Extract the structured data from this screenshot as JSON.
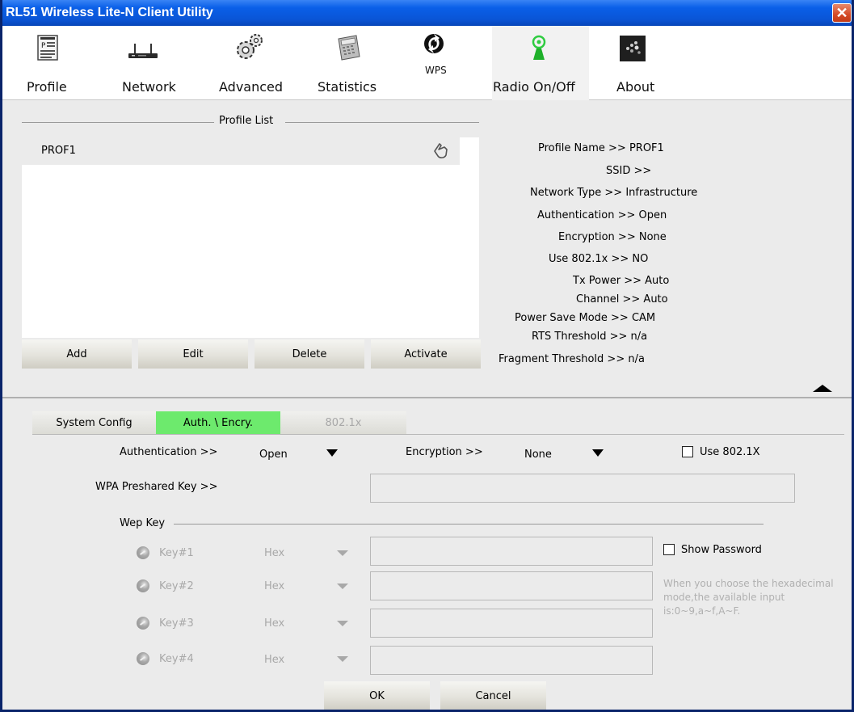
{
  "window": {
    "title": "RL51 Wireless Lite-N Client Utility",
    "close_glyph": "✕"
  },
  "toolbar": {
    "items": [
      {
        "label": "Profile",
        "icon": "profile-icon"
      },
      {
        "label": "Network",
        "icon": "router-icon"
      },
      {
        "label": "Advanced",
        "icon": "gears-icon"
      },
      {
        "label": "Statistics",
        "icon": "calculator-icon"
      },
      {
        "label": "WPS",
        "icon": "wps-icon"
      },
      {
        "label": "Radio On/Off",
        "icon": "radio-antenna-icon"
      },
      {
        "label": "About",
        "icon": "about-icon"
      }
    ]
  },
  "profile_list": {
    "header": "Profile List",
    "rows": [
      {
        "name": "PROF1",
        "icon": "hand-pointer-icon"
      }
    ],
    "buttons": {
      "add": "Add",
      "edit": "Edit",
      "delete": "Delete",
      "activate": "Activate"
    }
  },
  "details": [
    {
      "text": "Profile Name >> PROF1"
    },
    {
      "text": "SSID >>"
    },
    {
      "text": "Network Type >> Infrastructure"
    },
    {
      "text": "Authentication >> Open"
    },
    {
      "text": "Encryption >> None"
    },
    {
      "text": "Use 802.1x >> NO"
    },
    {
      "text": "Tx Power >> Auto"
    },
    {
      "text": "Channel >> Auto"
    },
    {
      "text": "Power Save Mode >> CAM"
    },
    {
      "text": "RTS Threshold >> n/a"
    },
    {
      "text": "Fragment Threshold >> n/a"
    }
  ],
  "tabs": {
    "system_config": "System Config",
    "auth_encry": "Auth. \\ Encry.",
    "dot1x": "802.1x",
    "active": "auth_encry"
  },
  "auth_form": {
    "authentication_label": "Authentication >>",
    "authentication_value": "Open",
    "encryption_label": "Encryption >>",
    "encryption_value": "None",
    "use8021x_label": "Use 802.1X",
    "use8021x_checked": false,
    "wpa_label": "WPA Preshared Key >>",
    "wpa_value": "",
    "wep_label": "Wep Key",
    "keys": [
      {
        "label": "Key#1",
        "type": "Hex",
        "value": ""
      },
      {
        "label": "Key#2",
        "type": "Hex",
        "value": ""
      },
      {
        "label": "Key#3",
        "type": "Hex",
        "value": ""
      },
      {
        "label": "Key#4",
        "type": "Hex",
        "value": ""
      }
    ],
    "show_password_label": "Show Password",
    "show_password_checked": false,
    "hint": "When you choose the hexadecimal mode,the available input is:0~9,a~f,A~F.",
    "ok": "OK",
    "cancel": "Cancel"
  },
  "colors": {
    "title_bar": "#0a55d6",
    "active_tab": "#6dea6d",
    "disabled_text": "#a8a8a8"
  }
}
